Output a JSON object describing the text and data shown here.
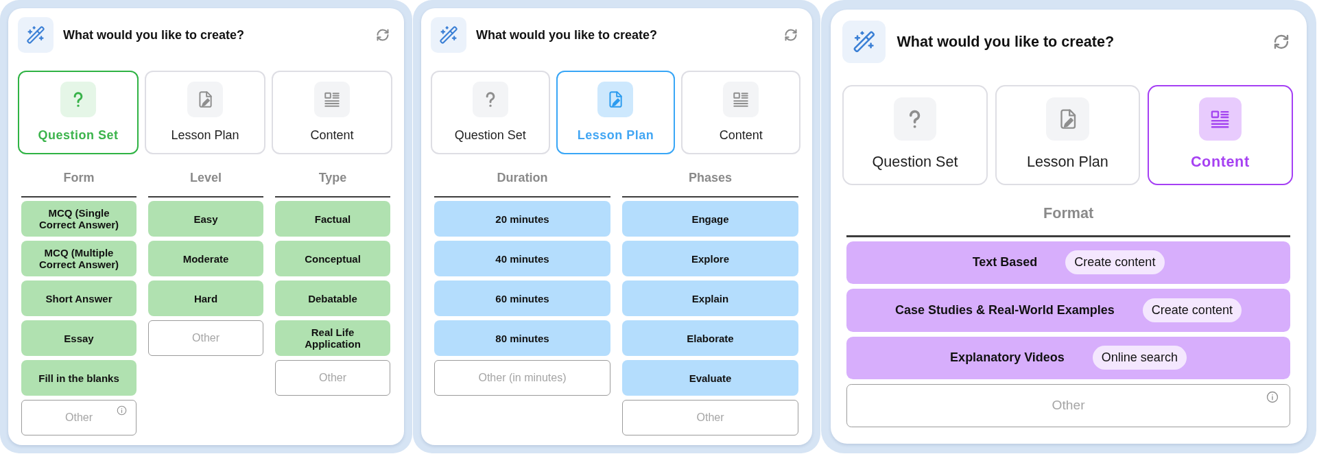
{
  "panels": [
    {
      "title": "What would you like to create?",
      "tabs": [
        {
          "kind": "question",
          "label": "Question Set",
          "selected": true
        },
        {
          "kind": "lesson",
          "label": "Lesson Plan",
          "selected": false
        },
        {
          "kind": "content",
          "label": "Content",
          "selected": false
        }
      ],
      "groups": [
        {
          "heading": "Form",
          "options": [
            {
              "label": "MCQ (Single Correct Answer)"
            },
            {
              "label": "MCQ (Multiple Correct Answer)"
            },
            {
              "label": "Short Answer"
            },
            {
              "label": "Essay"
            },
            {
              "label": "Fill in the blanks"
            }
          ],
          "other": {
            "placeholder": "Other",
            "info_icon": true
          }
        },
        {
          "heading": "Level",
          "options": [
            {
              "label": "Easy"
            },
            {
              "label": "Moderate"
            },
            {
              "label": "Hard"
            }
          ],
          "other": {
            "placeholder": "Other",
            "info_icon": false
          }
        },
        {
          "heading": "Type",
          "options": [
            {
              "label": "Factual"
            },
            {
              "label": "Conceptual"
            },
            {
              "label": "Debatable"
            },
            {
              "label": "Real Life Application"
            }
          ],
          "other": {
            "placeholder": "Other",
            "info_icon": false
          }
        }
      ]
    },
    {
      "title": "What would you like to create?",
      "tabs": [
        {
          "kind": "question",
          "label": "Question Set",
          "selected": false
        },
        {
          "kind": "lesson",
          "label": "Lesson Plan",
          "selected": true
        },
        {
          "kind": "content",
          "label": "Content",
          "selected": false
        }
      ],
      "groups": [
        {
          "heading": "Duration",
          "options": [
            {
              "label": "20 minutes"
            },
            {
              "label": "40 minutes"
            },
            {
              "label": "60 minutes"
            },
            {
              "label": "80 minutes"
            }
          ],
          "other": {
            "placeholder": "Other (in minutes)",
            "info_icon": false
          }
        },
        {
          "heading": "Phases",
          "options": [
            {
              "label": "Engage"
            },
            {
              "label": "Explore"
            },
            {
              "label": "Explain"
            },
            {
              "label": "Elaborate"
            },
            {
              "label": "Evaluate"
            }
          ],
          "other": {
            "placeholder": "Other",
            "info_icon": false
          }
        }
      ]
    },
    {
      "title": "What would you like to create?",
      "tabs": [
        {
          "kind": "question",
          "label": "Question Set",
          "selected": false
        },
        {
          "kind": "lesson",
          "label": "Lesson Plan",
          "selected": false
        },
        {
          "kind": "content",
          "label": "Content",
          "selected": true
        }
      ],
      "groups": [
        {
          "heading": "Format",
          "options": [
            {
              "label": "Text Based",
              "action": "Create content"
            },
            {
              "label": "Case Studies & Real-World Examples",
              "action": "Create content"
            },
            {
              "label": "Explanatory Videos",
              "action": "Online search"
            }
          ],
          "other": {
            "placeholder": "Other",
            "info_icon": true
          }
        }
      ]
    }
  ]
}
